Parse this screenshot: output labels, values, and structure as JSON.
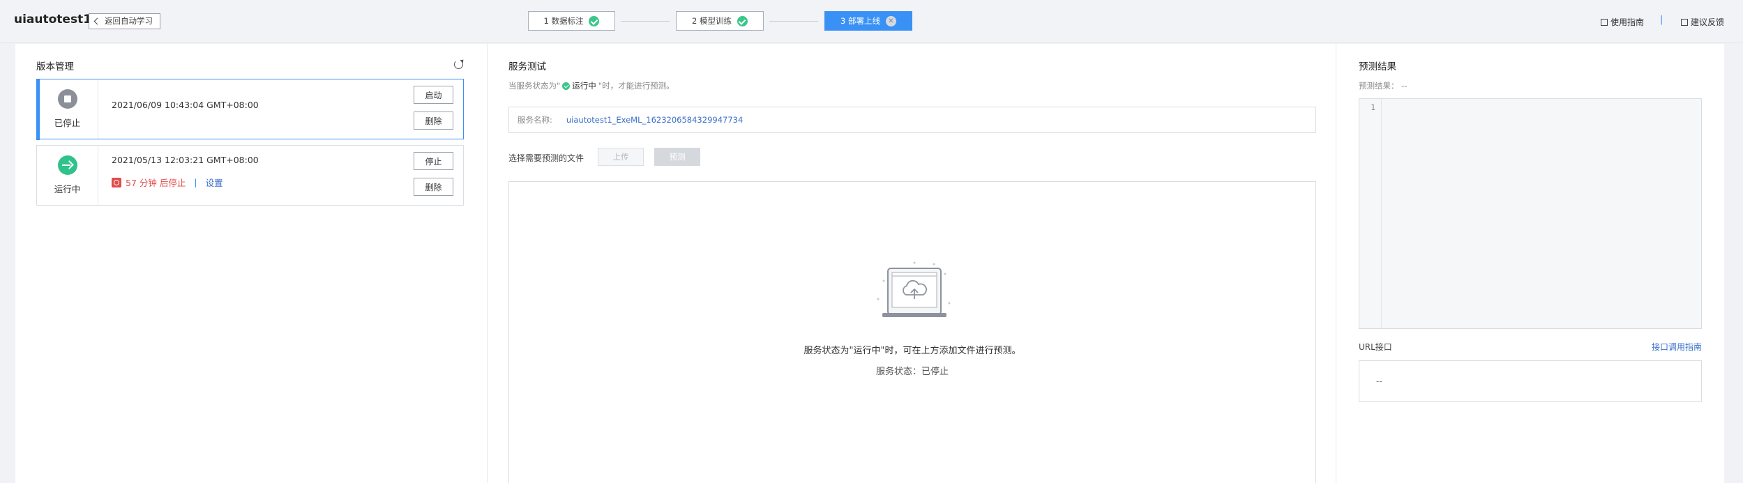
{
  "header": {
    "app_title": "uiautotest1",
    "back_label": "返回自动学习",
    "steps": [
      {
        "label": "1 数据标注",
        "state": "done"
      },
      {
        "label": "2 模型训练",
        "state": "done"
      },
      {
        "label": "3 部署上线",
        "state": "active"
      }
    ],
    "help_guide": "使用指南",
    "feedback": "建议反馈",
    "sep": "|"
  },
  "versions": {
    "title": "版本管理",
    "items": [
      {
        "status": "已停止",
        "time": "2021/06/09 10:43:04 GMT+08:00",
        "buttons": [
          "启动",
          "删除"
        ],
        "selected": true
      },
      {
        "status": "运行中",
        "time": "2021/05/13 12:03:21 GMT+08:00",
        "countdown": "57 分钟 后停止",
        "sep": "|",
        "setting": "设置",
        "buttons": [
          "停止",
          "删除"
        ]
      }
    ]
  },
  "service_test": {
    "title": "服务测试",
    "hint_prefix": "当服务状态为\"",
    "hint_status": "运行中",
    "hint_suffix": "\"时，才能进行预测。",
    "name_label": "服务名称:",
    "name_value": "uiautotest1_ExeML_1623206584329947734",
    "file_label": "选择需要预测的文件",
    "upload_btn": "上传",
    "predict_btn": "预测",
    "empty_msg": "服务状态为\"运行中\"时，可在上方添加文件进行预测。",
    "status_text": "服务状态：已停止"
  },
  "prediction": {
    "title": "预测结果",
    "result_label": "预测结果：  --",
    "line_number": "1",
    "url_label": "URL接口",
    "url_guide": "接口调用指南",
    "url_value": "--"
  },
  "colors": {
    "accent": "#3a91f5",
    "success": "#3cc68a",
    "danger": "#e14b4b",
    "link": "#3a6fc9"
  }
}
